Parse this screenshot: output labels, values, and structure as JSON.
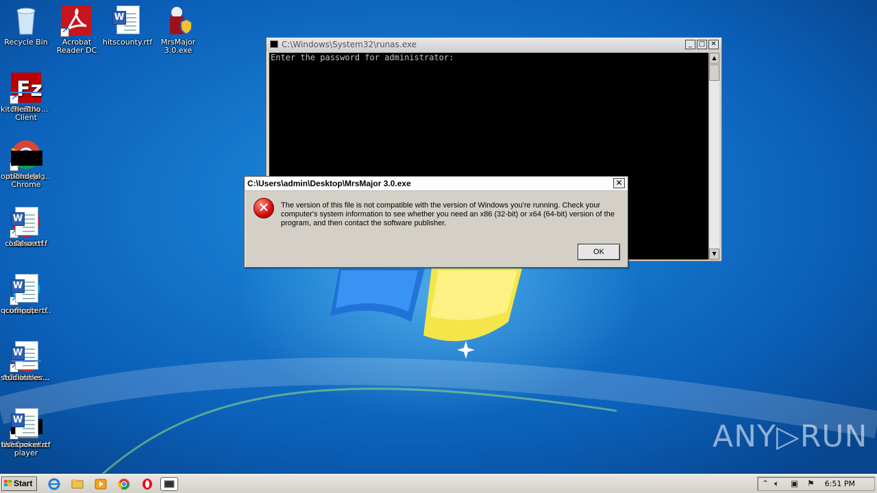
{
  "desktop_icons": [
    {
      "label": "Recycle Bin",
      "icon": "recycle-bin-icon"
    },
    {
      "label": "Acrobat Reader DC",
      "icon": "acrobat-icon"
    },
    {
      "label": "hitscounty.rtf",
      "icon": "word-document-icon"
    },
    {
      "label": "MrsMajor 3.0.exe",
      "icon": "mrsmajor-exe-icon"
    },
    {
      "label": "Firefox",
      "icon": "firefox-icon"
    },
    {
      "label": "FileZilla Client",
      "icon": "filezilla-icon"
    },
    {
      "label": "kitchenthou...",
      "icon": "file-icon"
    },
    {
      "label": "Google Chrome",
      "icon": "chrome-icon"
    },
    {
      "label": "calllos.jpg",
      "icon": "image-thumbnail-icon"
    },
    {
      "label": "optiondeal.jpg",
      "icon": "image-thumbnail-icon"
    },
    {
      "label": "Opera",
      "icon": "opera-icon"
    },
    {
      "label": "clubtrue.rtf",
      "icon": "word-document-icon"
    },
    {
      "label": "osalso.rtf",
      "icon": "word-document-icon"
    },
    {
      "label": "Skype",
      "icon": "skype-icon"
    },
    {
      "label": "comezip.rtf",
      "icon": "word-document-icon"
    },
    {
      "label": "qcomputer.rtf",
      "icon": "word-document-icon"
    },
    {
      "label": "CCleaner",
      "icon": "ccleaner-icon"
    },
    {
      "label": "featurerec...",
      "icon": "word-document-icon"
    },
    {
      "label": "studiotitles....",
      "icon": "file-icon"
    },
    {
      "label": "VLC media player",
      "icon": "vlc-icon"
    },
    {
      "label": "filescancer.jpg",
      "icon": "image-thumbnail-icon"
    },
    {
      "label": "usespoker.rtf",
      "icon": "word-document-icon"
    }
  ],
  "console": {
    "title": "C:\\Windows\\System32\\runas.exe",
    "output": "Enter the password for administrator:"
  },
  "dialog": {
    "title": "C:\\Users\\admin\\Desktop\\MrsMajor 3.0.exe",
    "message": "The version of this file is not compatible with the version of Windows you're running. Check your computer's system information to see whether you need an x86 (32-bit) or x64 (64-bit) version of the program, and then contact the software publisher.",
    "ok_label": "OK"
  },
  "watermark": "ANY▷RUN",
  "taskbar": {
    "start_label": "Start",
    "pinned": [
      "internet-explorer-icon",
      "file-explorer-icon",
      "media-player-icon",
      "chrome-icon",
      "opera-icon",
      "console-icon"
    ],
    "clock": "6:51 PM"
  },
  "colors": {
    "desktop_blue": "#0b5fb8",
    "error_red": "#d01010",
    "console_bg": "#000000",
    "console_text": "#c0c0c0"
  }
}
